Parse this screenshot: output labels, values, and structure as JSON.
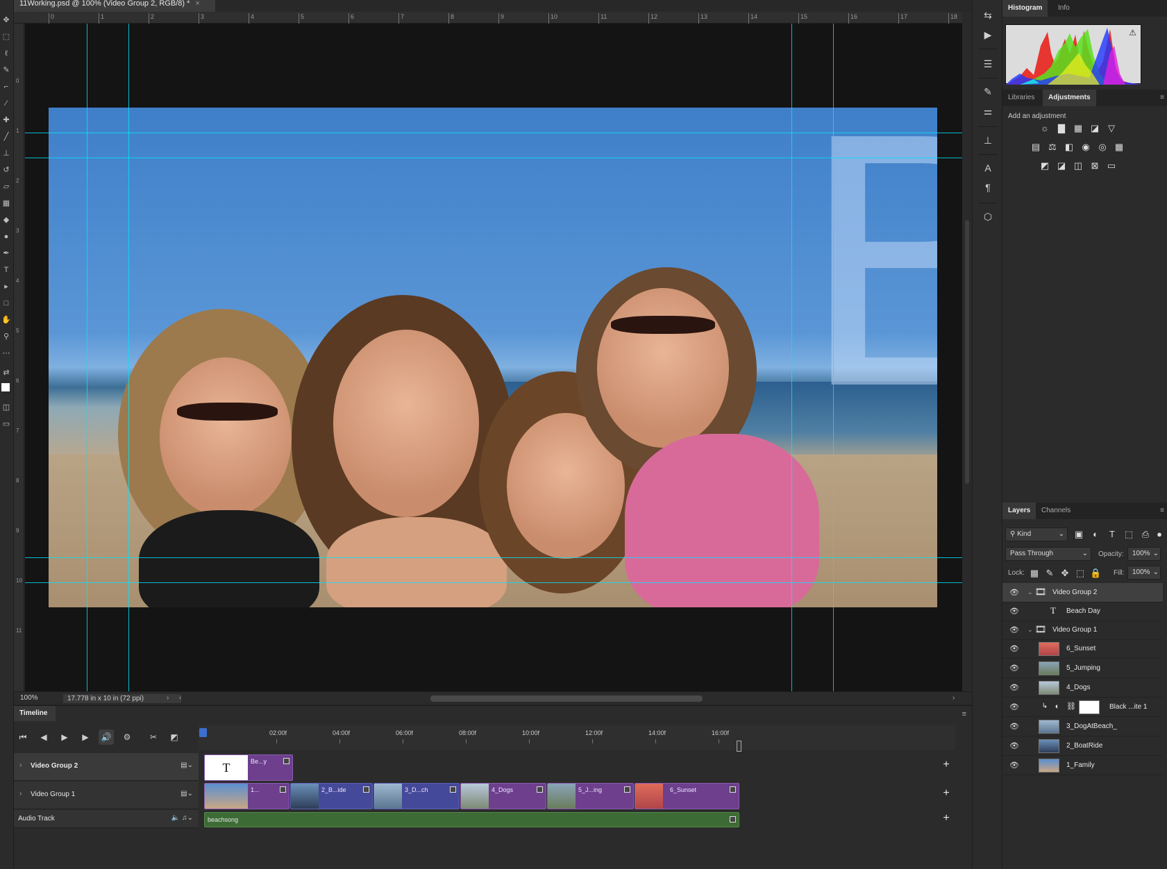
{
  "document": {
    "tab_title": "11Working.psd @ 100% (Video Group 2, RGB/8) *",
    "close_glyph": "×",
    "zoom": "100%",
    "dimensions": "17.778 in x 10 in (72 ppi)",
    "overlay_letter": "B"
  },
  "ruler": {
    "top_labels": [
      "0",
      "1",
      "2",
      "3",
      "4",
      "5",
      "6",
      "7",
      "8",
      "9",
      "10",
      "11",
      "12",
      "13",
      "14",
      "15",
      "16",
      "17",
      "18"
    ],
    "left_labels": [
      "0",
      "1",
      "2",
      "3",
      "4",
      "5",
      "6",
      "7",
      "8",
      "9",
      "10",
      "11"
    ]
  },
  "timeline": {
    "tab_label": "Timeline",
    "time_labels": [
      "02:00f",
      "04:00f",
      "06:00f",
      "08:00f",
      "10:00f",
      "12:00f",
      "14:00f",
      "16:00f"
    ],
    "tracks": [
      {
        "name": "Video Group 2"
      },
      {
        "name": "Video Group 1"
      },
      {
        "name": "Audio Track"
      }
    ],
    "group2_clips": [
      {
        "label": "Be...y"
      }
    ],
    "group1_clips": [
      {
        "label": "1..."
      },
      {
        "label": "2_B...ide"
      },
      {
        "label": "3_D...ch"
      },
      {
        "label": "4_Dogs"
      },
      {
        "label": "5_J...ing"
      },
      {
        "label": "6_Sunset"
      }
    ],
    "audio_clip": "beachsong"
  },
  "panels": {
    "top_tabs": [
      "Histogram",
      "Info"
    ],
    "mid_tabs": [
      "Libraries",
      "Adjustments"
    ],
    "add_adjustment": "Add an adjustment",
    "layer_tabs": [
      "Layers",
      "Channels"
    ],
    "filter_kind": "Kind",
    "blend_mode": "Pass Through",
    "opacity_label": "Opacity:",
    "opacity_value": "100%",
    "lock_label": "Lock:",
    "fill_label": "Fill:",
    "fill_value": "100%"
  },
  "layers": [
    {
      "name": "Video Group 2",
      "kind": "group",
      "selected": true
    },
    {
      "name": "Beach Day",
      "kind": "text"
    },
    {
      "name": "Video Group 1",
      "kind": "group"
    },
    {
      "name": "6_Sunset",
      "kind": "video"
    },
    {
      "name": "5_Jumping",
      "kind": "video"
    },
    {
      "name": "4_Dogs",
      "kind": "video"
    },
    {
      "name": "Black ...ite 1",
      "kind": "adjustment"
    },
    {
      "name": "3_DogAtBeach_",
      "kind": "video"
    },
    {
      "name": "2_BoatRide",
      "kind": "video"
    },
    {
      "name": "1_Family",
      "kind": "video"
    }
  ]
}
